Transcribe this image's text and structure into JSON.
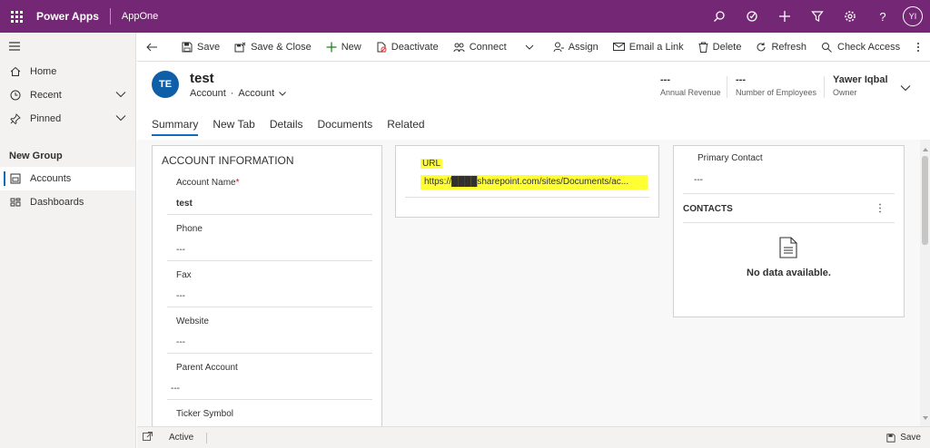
{
  "topbar": {
    "app_name": "Power Apps",
    "app_sub": "AppOne",
    "user_initials": "YI",
    "icons": [
      "search-icon",
      "lightbulb-icon",
      "plus-icon",
      "filter-icon",
      "gear-icon",
      "help-icon"
    ]
  },
  "sidebar": {
    "items": [
      {
        "label": "Home",
        "icon": "home-icon"
      },
      {
        "label": "Recent",
        "icon": "clock-icon"
      },
      {
        "label": "Pinned",
        "icon": "pin-icon"
      }
    ],
    "group_label": "New Group",
    "group_items": [
      {
        "label": "Accounts",
        "icon": "accounts-icon"
      },
      {
        "label": "Dashboards",
        "icon": "dashboards-icon"
      }
    ]
  },
  "commandbar": {
    "save": "Save",
    "save_close": "Save & Close",
    "new": "New",
    "deactivate": "Deactivate",
    "connect": "Connect",
    "assign": "Assign",
    "email_link": "Email a Link",
    "delete": "Delete",
    "refresh": "Refresh",
    "check_access": "Check Access"
  },
  "header": {
    "avatar": "TE",
    "title": "test",
    "entity": "Account",
    "form": "Account",
    "annual_revenue_value": "---",
    "annual_revenue_label": "Annual Revenue",
    "employees_value": "---",
    "employees_label": "Number of Employees",
    "owner_value": "Yawer Iqbal",
    "owner_label": "Owner"
  },
  "tabs": [
    "Summary",
    "New Tab",
    "Details",
    "Documents",
    "Related"
  ],
  "account_info": {
    "title": "ACCOUNT INFORMATION",
    "fields": [
      {
        "label": "Account Name",
        "value": "test"
      },
      {
        "label": "Phone",
        "value": "---"
      },
      {
        "label": "Fax",
        "value": "---"
      },
      {
        "label": "Website",
        "value": "---"
      },
      {
        "label": "Parent Account",
        "value": "---"
      },
      {
        "label": "Ticker Symbol",
        "value": ""
      }
    ]
  },
  "url_section": {
    "label": "URL",
    "value": "https://████sharepoint.com/sites/Documents/ac..."
  },
  "contact_section": {
    "primary_contact_label": "Primary Contact",
    "primary_contact_value": "---",
    "contacts_title": "CONTACTS",
    "no_data": "No data available."
  },
  "statusbar": {
    "status": "Active",
    "save": "Save"
  }
}
